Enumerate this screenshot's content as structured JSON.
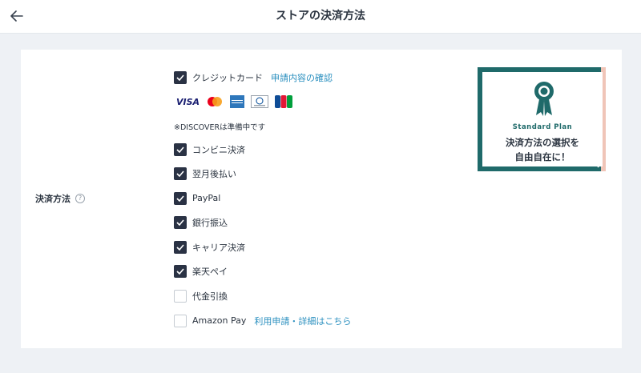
{
  "header": {
    "title": "ストアの決済方法"
  },
  "section": {
    "label": "決済方法",
    "help_glyph": "?"
  },
  "credit": {
    "label": "クレジットカード",
    "link": "申請内容の確認",
    "checked": true
  },
  "brands": {
    "visa": "VISA",
    "items": [
      "visa-logo",
      "mastercard-logo",
      "amex-logo",
      "diners-club-logo",
      "jcb-logo"
    ]
  },
  "note": "※DISCOVERは準備中です",
  "options": [
    {
      "label": "コンビニ決済",
      "checked": true
    },
    {
      "label": "翌月後払い",
      "checked": true
    },
    {
      "label": "PayPal",
      "checked": true
    },
    {
      "label": "銀行振込",
      "checked": true
    },
    {
      "label": "キャリア決済",
      "checked": true
    },
    {
      "label": "楽天ペイ",
      "checked": true
    },
    {
      "label": "代金引換",
      "checked": false
    }
  ],
  "amazon": {
    "label": "Amazon Pay",
    "link": "利用申請・詳細はこちら",
    "checked": false
  },
  "banner": {
    "plan": "Standard Plan",
    "line1": "決済方法の選択を",
    "line2": "自由自在に！"
  },
  "colors": {
    "checkbox_on": "#2a3244",
    "link": "#2a8fbf",
    "banner_teal": "#1f6a6a",
    "background": "#eef1f5"
  }
}
